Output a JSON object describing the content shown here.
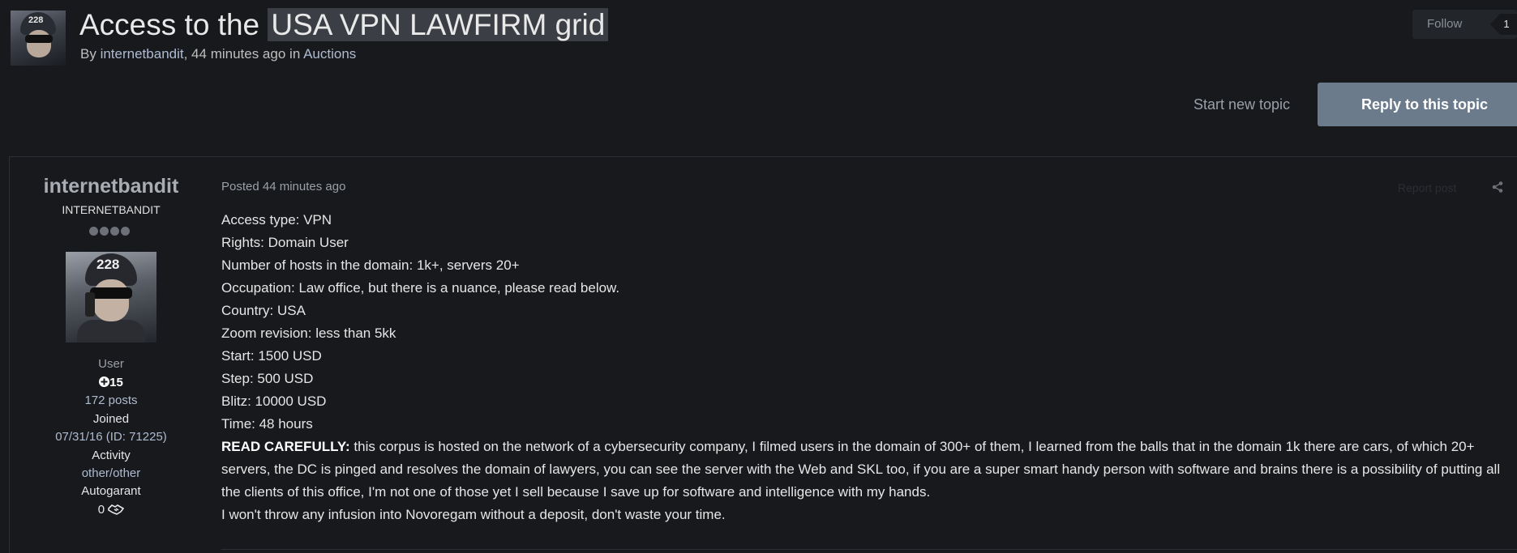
{
  "topic": {
    "title_prefix": "Access to the ",
    "title_highlight": "USA VPN LAWFIRM grid",
    "by_label": "By",
    "author": "internetbandit",
    "time": ", 44 minutes ago",
    "in_label": "in",
    "forum": "Auctions"
  },
  "follow": {
    "label": "Follow",
    "count": "1"
  },
  "actions": {
    "start_topic": "Start new topic",
    "reply": "Reply to this topic"
  },
  "post": {
    "author": {
      "name": "internetbandit",
      "title": "INTERNETBANDIT",
      "pips": 4,
      "group": "User",
      "reputation": "15",
      "posts": "172 posts",
      "joined_label": "Joined",
      "joined": "07/31/16 (ID: 71225)",
      "activity_label": "Activity",
      "activity": "other/other",
      "autogarant_label": "Autogarant",
      "autogarant": "0"
    },
    "posted_label": "Posted",
    "posted_time": "44 minutes ago",
    "report": "Report post",
    "lines": [
      "Access type: VPN",
      "Rights: Domain User",
      "Number of hosts in the domain: 1k+, servers 20+",
      "Occupation: Law office, but there is a nuance, please read below.",
      "Country: USA",
      "Zoom revision: less than 5kk",
      "Start: 1500 USD",
      "Step: 500 USD",
      "Blitz: 10000 USD",
      "Time: 48 hours"
    ],
    "read_carefully_label": "READ CAREFULLY:",
    "read_carefully_text": " this corpus is hosted on the network of a cybersecurity company, I filmed users in the domain of 300+ of them, I learned from the balls that in the domain 1k there are cars, of which 20+ servers, the DC is pinged and resolves the domain of lawyers, you can see the server with the Web and SKL too, if you are a super smart handy person with software and brains there is a possibility of putting all the clients of this office, I'm not one of those yet I sell because I save up for software and intelligence with my hands.",
    "final_line": "I won't throw any infusion into Novoregam without a deposit, don't waste your time."
  },
  "colors": {
    "background": "#17191d",
    "accent": "#6b7b8c",
    "link": "#aebbd0"
  },
  "icons": [
    "author-avatar",
    "follow-count-badge",
    "reputation-plus-icon",
    "handshake-icon",
    "share-icon"
  ]
}
